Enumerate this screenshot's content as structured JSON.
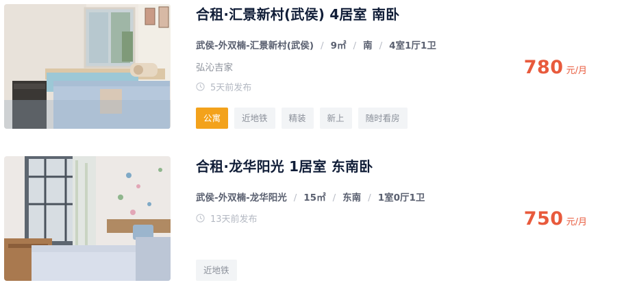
{
  "listings": [
    {
      "title": "合租·汇景新村(武侯) 4居室 南卧",
      "meta": [
        "武侯-外双楠-汇景新村(武侯)",
        "9㎡",
        "南",
        "4室1厅1卫"
      ],
      "agent": "弘沁吉家",
      "time": "5天前发布",
      "tags": [
        {
          "label": "公寓",
          "primary": true
        },
        {
          "label": "近地铁",
          "primary": false
        },
        {
          "label": "精装",
          "primary": false
        },
        {
          "label": "新上",
          "primary": false
        },
        {
          "label": "随时看房",
          "primary": false
        }
      ],
      "price": "780",
      "price_unit": "元/月"
    },
    {
      "title": "合租·龙华阳光 1居室 东南卧",
      "meta": [
        "武侯-外双楠-龙华阳光",
        "15㎡",
        "东南",
        "1室0厅1卫"
      ],
      "time": "13天前发布",
      "tags": [
        {
          "label": "近地铁",
          "primary": false
        }
      ],
      "price": "750",
      "price_unit": "元/月"
    }
  ],
  "colors": {
    "price": "#e85a3c",
    "primary_tag": "#f3a21b",
    "title": "#101d37"
  },
  "icons": {
    "time": "clock-icon"
  }
}
